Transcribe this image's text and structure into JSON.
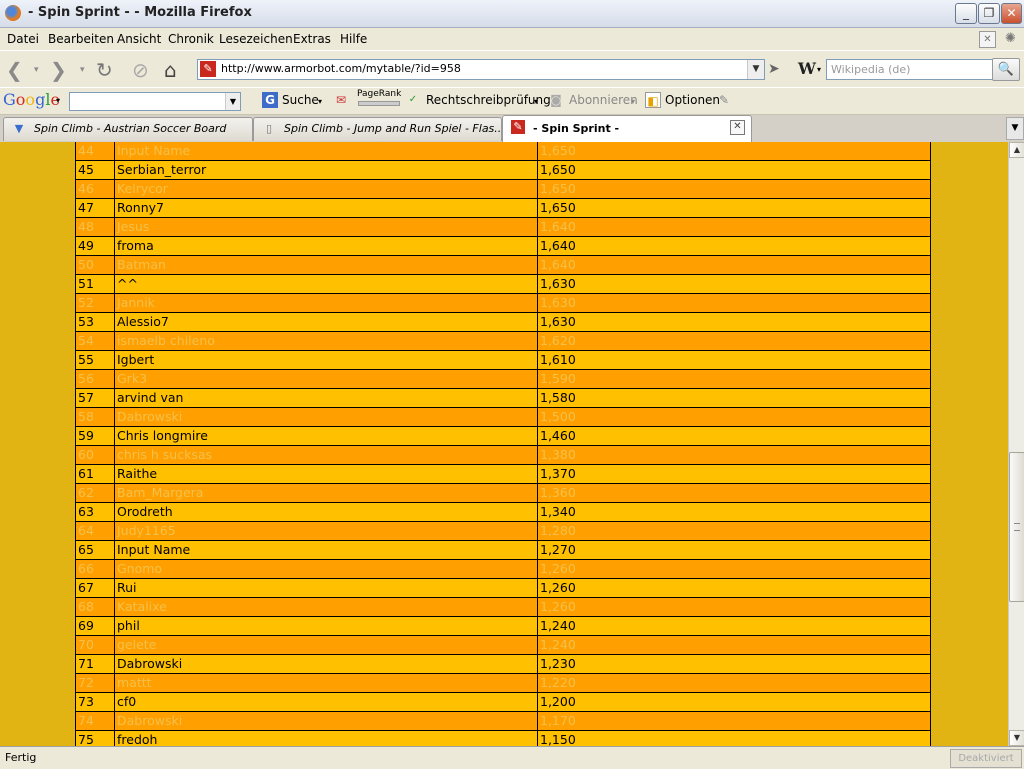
{
  "window": {
    "title": "- Spin Sprint - - Mozilla Firefox"
  },
  "menu": [
    "Datei",
    "Bearbeiten",
    "Ansicht",
    "Chronik",
    "Lesezeichen",
    "Extras",
    "Hilfe"
  ],
  "address": {
    "url": "http://www.armorbot.com/mytable/?id=958"
  },
  "wiki": {
    "placeholder": "Wikipedia (de)"
  },
  "google_toolbar": {
    "logo": "Google",
    "search_label": "Suche",
    "pagerank_label": "PageRank",
    "spell_label": "Rechtschreibprüfung",
    "subscribe_label": "Abonnieren",
    "options_label": "Optionen"
  },
  "tabs": [
    {
      "label": "Spin Climb - Austrian Soccer Board",
      "active": false
    },
    {
      "label": "Spin Climb - Jump and Run Spiel - Flas...",
      "active": false
    },
    {
      "label": "- Spin Sprint -",
      "active": true
    }
  ],
  "leaderboard": {
    "colors": {
      "odd_row": "#ffc000",
      "even_row": "#ffa000",
      "even_text": "#f3c04a",
      "page_bg": "#e2b413"
    },
    "rows": [
      {
        "rank": "44",
        "name": "Input Name",
        "score": "1,650"
      },
      {
        "rank": "45",
        "name": "Serbian_terror",
        "score": "1,650"
      },
      {
        "rank": "46",
        "name": "Kelrycor",
        "score": "1,650"
      },
      {
        "rank": "47",
        "name": "Ronny7",
        "score": "1,650"
      },
      {
        "rank": "48",
        "name": "Jesus",
        "score": "1,640"
      },
      {
        "rank": "49",
        "name": "froma",
        "score": "1,640"
      },
      {
        "rank": "50",
        "name": "Batman",
        "score": "1,640"
      },
      {
        "rank": "51",
        "name": "^^",
        "score": "1,630"
      },
      {
        "rank": "52",
        "name": "Jannik",
        "score": "1,630"
      },
      {
        "rank": "53",
        "name": "Alessio7",
        "score": "1,630"
      },
      {
        "rank": "54",
        "name": "ismaelb chileno",
        "score": "1,620"
      },
      {
        "rank": "55",
        "name": "Igbert",
        "score": "1,610"
      },
      {
        "rank": "56",
        "name": "Grk3",
        "score": "1,590"
      },
      {
        "rank": "57",
        "name": "arvind van",
        "score": "1,580"
      },
      {
        "rank": "58",
        "name": "Dabrowski",
        "score": "1,500"
      },
      {
        "rank": "59",
        "name": "Chris longmire",
        "score": "1,460"
      },
      {
        "rank": "60",
        "name": "chris h sucksas",
        "score": "1,380"
      },
      {
        "rank": "61",
        "name": "Raithe",
        "score": "1,370"
      },
      {
        "rank": "62",
        "name": "Bam_Margera",
        "score": "1,360"
      },
      {
        "rank": "63",
        "name": "Orodreth",
        "score": "1,340"
      },
      {
        "rank": "64",
        "name": "Judy1165",
        "score": "1,280"
      },
      {
        "rank": "65",
        "name": "Input Name",
        "score": "1,270"
      },
      {
        "rank": "66",
        "name": "Gnomo",
        "score": "1,260"
      },
      {
        "rank": "67",
        "name": "Rui",
        "score": "1,260"
      },
      {
        "rank": "68",
        "name": "Katalixe",
        "score": "1,260"
      },
      {
        "rank": "69",
        "name": "phil",
        "score": "1,240"
      },
      {
        "rank": "70",
        "name": "gelete",
        "score": "1,240"
      },
      {
        "rank": "71",
        "name": "Dabrowski",
        "score": "1,230"
      },
      {
        "rank": "72",
        "name": "mattt",
        "score": "1,220"
      },
      {
        "rank": "73",
        "name": "cf0",
        "score": "1,200"
      },
      {
        "rank": "74",
        "name": "Dabrowski",
        "score": "1,170"
      },
      {
        "rank": "75",
        "name": "fredoh",
        "score": "1,150"
      }
    ]
  },
  "status": {
    "text": "Fertig",
    "deactivated": "Deaktiviert"
  }
}
